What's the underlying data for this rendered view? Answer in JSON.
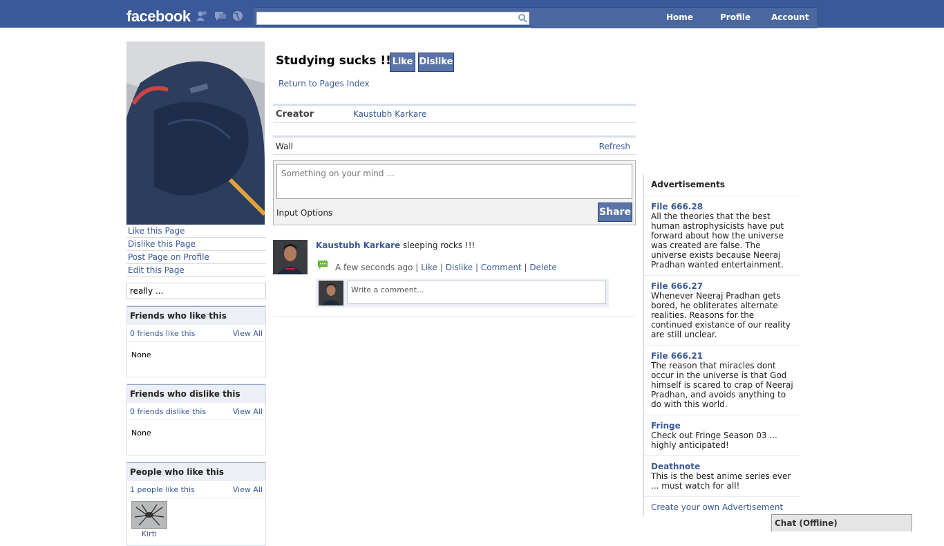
{
  "topbar": {
    "logo": "facebook",
    "search": {
      "placeholder": "",
      "value": ""
    },
    "nav": [
      {
        "label": "Home"
      },
      {
        "label": "Profile"
      },
      {
        "label": "Account"
      }
    ]
  },
  "sidebar": {
    "actions": [
      {
        "label": "Like this Page"
      },
      {
        "label": "Dislike this Page"
      },
      {
        "label": "Post Page on Profile"
      },
      {
        "label": "Edit this Page"
      }
    ],
    "status": "really ...",
    "boxes": [
      {
        "title": "Friends who like this",
        "count": "0 friends like this",
        "view_all": "View All",
        "body": "None"
      },
      {
        "title": "Friends who dislike this",
        "count": "0 friends dislike this",
        "view_all": "View All",
        "body": "None"
      },
      {
        "title": "People who like this",
        "count": "1 people like this",
        "view_all": "View All",
        "person": "Kirti"
      }
    ]
  },
  "main": {
    "title": "Studying sucks !!!",
    "like_label": "Like",
    "dislike_label": "Dislike",
    "return_link": "Return to Pages Index",
    "creator_label": "Creator",
    "creator_name": "Kaustubh Karkare",
    "wall_label": "Wall",
    "refresh_label": "Refresh",
    "composer": {
      "placeholder": "Something on your mind ...",
      "options_label": "Input Options",
      "share_label": "Share"
    },
    "story": {
      "author": "Kaustubh Karkare",
      "text": "sleeping rocks !!!",
      "time": "A few seconds ago",
      "sep": "|",
      "actions": [
        {
          "label": "Like"
        },
        {
          "label": "Dislike"
        },
        {
          "label": "Comment"
        },
        {
          "label": "Delete"
        }
      ],
      "comment_placeholder": "Write a comment..."
    }
  },
  "ads": {
    "title": "Advertisements",
    "items": [
      {
        "title": "File 666.28",
        "body": "All the theories that the best human astrophysicists have put forward about how the universe was created are false. The universe exists because Neeraj Pradhan wanted entertainment."
      },
      {
        "title": "File 666.27",
        "body": "Whenever Neeraj Pradhan gets bored, he obliterates alternate realities. Reasons for the continued existance of our reality are still unclear."
      },
      {
        "title": "File 666.21",
        "body": "The reason that miracles dont occur in the universe is that God himself is scared to crap of Neeraj Pradhan, and avoids anything to do with this world."
      },
      {
        "title": "Fringe",
        "body": "Check out Fringe Season 03 ... highly anticipated!"
      },
      {
        "title": "Deathnote",
        "body": "This is the best anime series ever ... must watch for all!"
      }
    ],
    "create_link": "Create your own Advertisement"
  },
  "chat": {
    "label": "Chat (Offline)"
  },
  "colors": {
    "brand": "#3b5998",
    "button": "#5b74a8",
    "link": "#3b5998"
  }
}
